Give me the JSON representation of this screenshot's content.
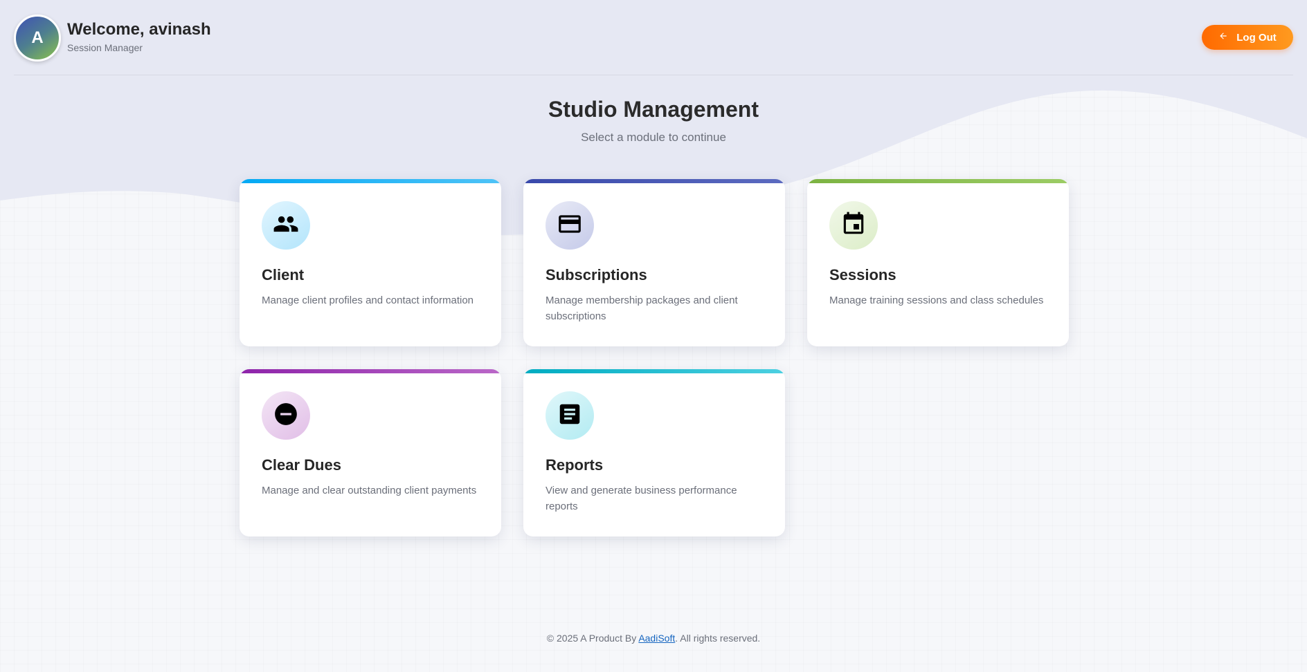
{
  "header": {
    "avatar_initial": "A",
    "welcome": "Welcome, avinash",
    "role": "Session Manager",
    "logout_label": "Log Out"
  },
  "main": {
    "title": "Studio Management",
    "subtitle": "Select a module to continue"
  },
  "modules": [
    {
      "title": "Client",
      "description": "Manage client profiles and contact information",
      "icon": "people-icon",
      "accent": "#29b6f6"
    },
    {
      "title": "Subscriptions",
      "description": "Manage membership packages and client subscriptions",
      "icon": "credit-card-icon",
      "accent": "#3f51b5"
    },
    {
      "title": "Sessions",
      "description": "Manage training sessions and class schedules",
      "icon": "calendar-icon",
      "accent": "#8bc34a"
    },
    {
      "title": "Clear Dues",
      "description": "Manage and clear outstanding client payments",
      "icon": "minus-circle-icon",
      "accent": "#9c27b0"
    },
    {
      "title": "Reports",
      "description": "View and generate business performance reports",
      "icon": "document-icon",
      "accent": "#26c6da"
    }
  ],
  "footer": {
    "prefix": "© 2025 A Product By ",
    "link": "AadiSoft",
    "suffix": ". All rights reserved."
  },
  "colors": {
    "logout_gradient_start": "#ff6a00",
    "logout_gradient_end": "#ff9a1f",
    "background": "#f6f7fa",
    "wave": "#e6e8f3"
  }
}
